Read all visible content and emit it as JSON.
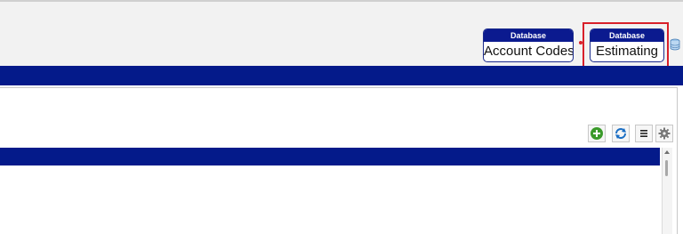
{
  "header": {
    "databases": [
      {
        "caption": "Database",
        "label": "Account Codes"
      },
      {
        "caption": "Database",
        "label": "Estimating"
      }
    ],
    "db_icon": "database-icon"
  },
  "toolbar": {
    "icons": [
      "add-icon",
      "refresh-icon",
      "list-icon",
      "settings-icon"
    ]
  },
  "colors": {
    "nav_blue": "#041a8a",
    "highlight_red": "#d8202a",
    "add_green": "#3a9a2a",
    "refresh_blue": "#1c6fc4"
  }
}
